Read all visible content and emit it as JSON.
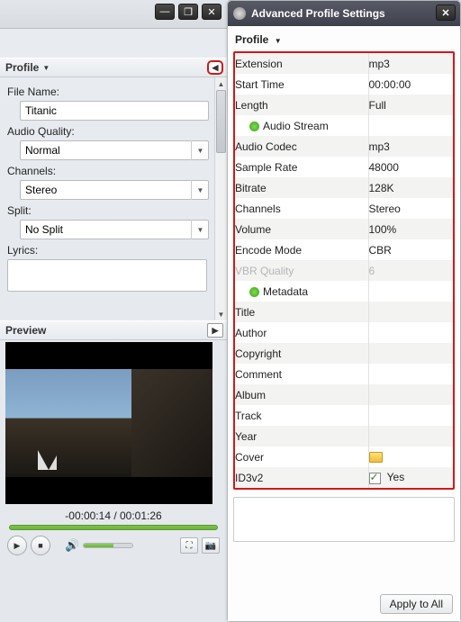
{
  "left": {
    "profile_header": "Profile",
    "preview_header": "Preview",
    "fields": {
      "file_name_label": "File Name:",
      "file_name_value": "Titanic",
      "audio_quality_label": "Audio Quality:",
      "audio_quality_value": "Normal",
      "channels_label": "Channels:",
      "channels_value": "Stereo",
      "split_label": "Split:",
      "split_value": "No Split",
      "lyrics_label": "Lyrics:"
    },
    "time": "-00:00:14 / 00:01:26"
  },
  "right": {
    "title": "Advanced Profile Settings",
    "profile_label": "Profile",
    "rows": [
      {
        "k": "Extension",
        "v": "mp3",
        "group": false
      },
      {
        "k": "Start Time",
        "v": "00:00:00",
        "group": false
      },
      {
        "k": "Length",
        "v": "Full",
        "group": false
      },
      {
        "k": "Audio Stream",
        "v": "",
        "group": true
      },
      {
        "k": "Audio Codec",
        "v": "mp3",
        "group": false
      },
      {
        "k": "Sample Rate",
        "v": "48000",
        "group": false
      },
      {
        "k": "Bitrate",
        "v": "128K",
        "group": false
      },
      {
        "k": "Channels",
        "v": "Stereo",
        "group": false
      },
      {
        "k": "Volume",
        "v": "100%",
        "group": false
      },
      {
        "k": "Encode Mode",
        "v": "CBR",
        "group": false
      },
      {
        "k": "VBR Quality",
        "v": "6",
        "group": false,
        "muted": true
      },
      {
        "k": "Metadata",
        "v": "",
        "group": true
      },
      {
        "k": "Title",
        "v": "",
        "group": false
      },
      {
        "k": "Author",
        "v": "",
        "group": false
      },
      {
        "k": "Copyright",
        "v": "",
        "group": false
      },
      {
        "k": "Comment",
        "v": "",
        "group": false
      },
      {
        "k": "Album",
        "v": "",
        "group": false
      },
      {
        "k": "Track",
        "v": "",
        "group": false
      },
      {
        "k": "Year",
        "v": "",
        "group": false
      },
      {
        "k": "Cover",
        "v": "",
        "group": false,
        "folder": true
      },
      {
        "k": "ID3v2",
        "v": "Yes",
        "group": false,
        "check": true
      }
    ],
    "apply_label": "Apply to All"
  }
}
